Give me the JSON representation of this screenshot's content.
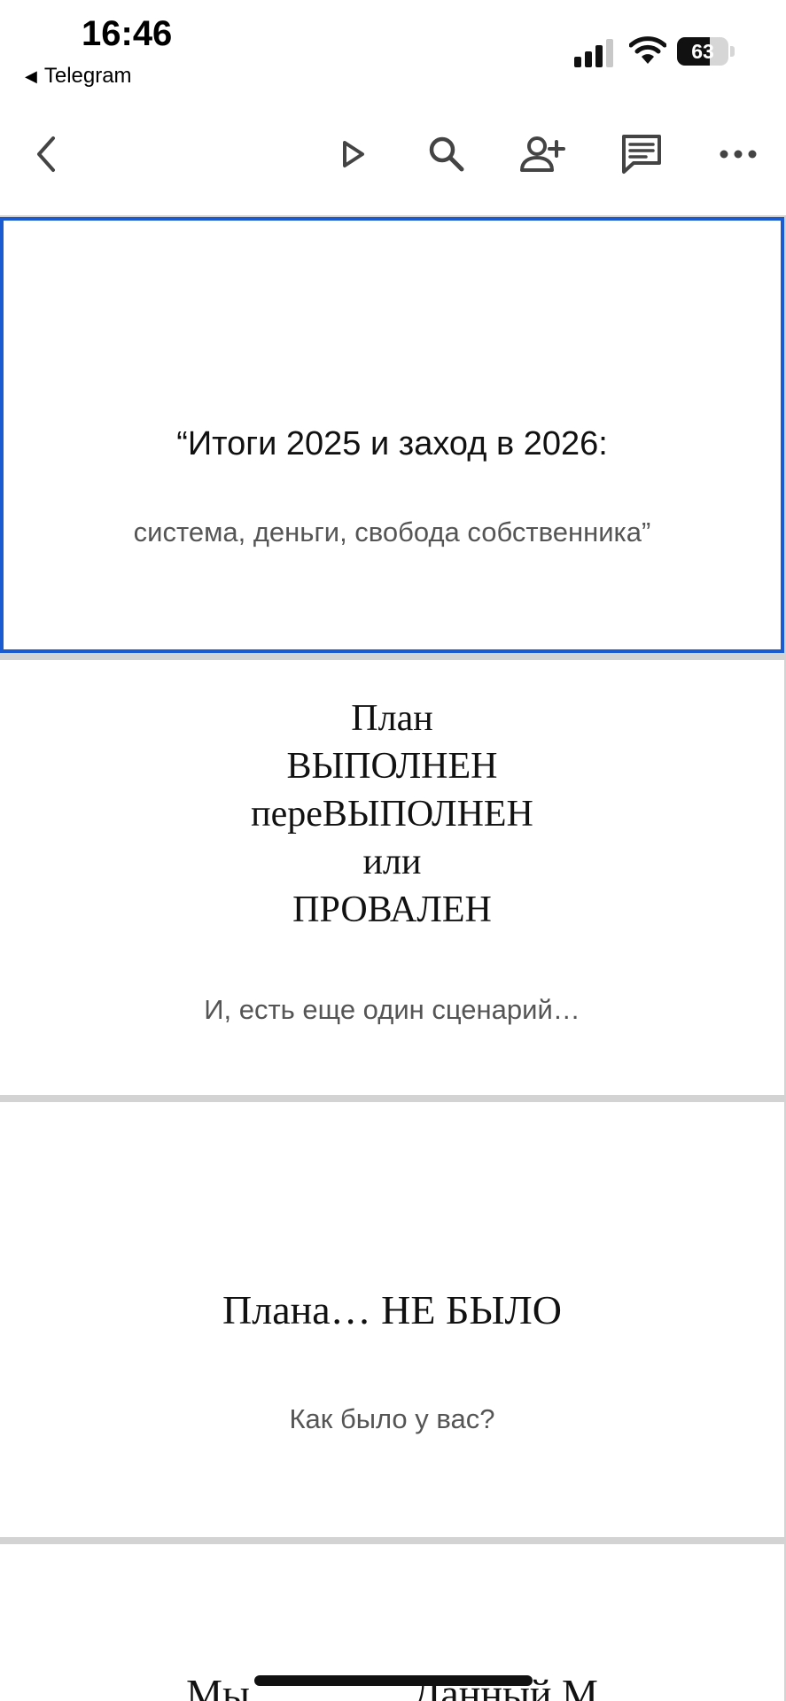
{
  "status_bar": {
    "time": "16:46",
    "back_app": "Telegram",
    "battery_percent": "63",
    "battery_level": 0.63
  },
  "toolbar": {
    "icons": [
      "back-icon",
      "play-icon",
      "search-icon",
      "add-person-icon",
      "comment-icon",
      "more-icon"
    ]
  },
  "slides": [
    {
      "title": "“Итоги 2025 и заход в 2026:",
      "subtitle": "система, деньги, свобода собственника”"
    },
    {
      "title_lines": [
        "План",
        "ВЫПОЛНЕН",
        "переВЫПОЛНЕН",
        "или",
        "ПРОВАЛЕН"
      ],
      "subtitle": "И, есть еще один сценарий…"
    },
    {
      "title": "Плана… НЕ БЫЛО",
      "subtitle": "Как было у вас?"
    },
    {
      "title": "Мы                Данный М"
    }
  ],
  "colors": {
    "accent_selection": "#1a5bd1",
    "slide_gap": "#d3d3d3",
    "subtitle_text": "#555555"
  }
}
